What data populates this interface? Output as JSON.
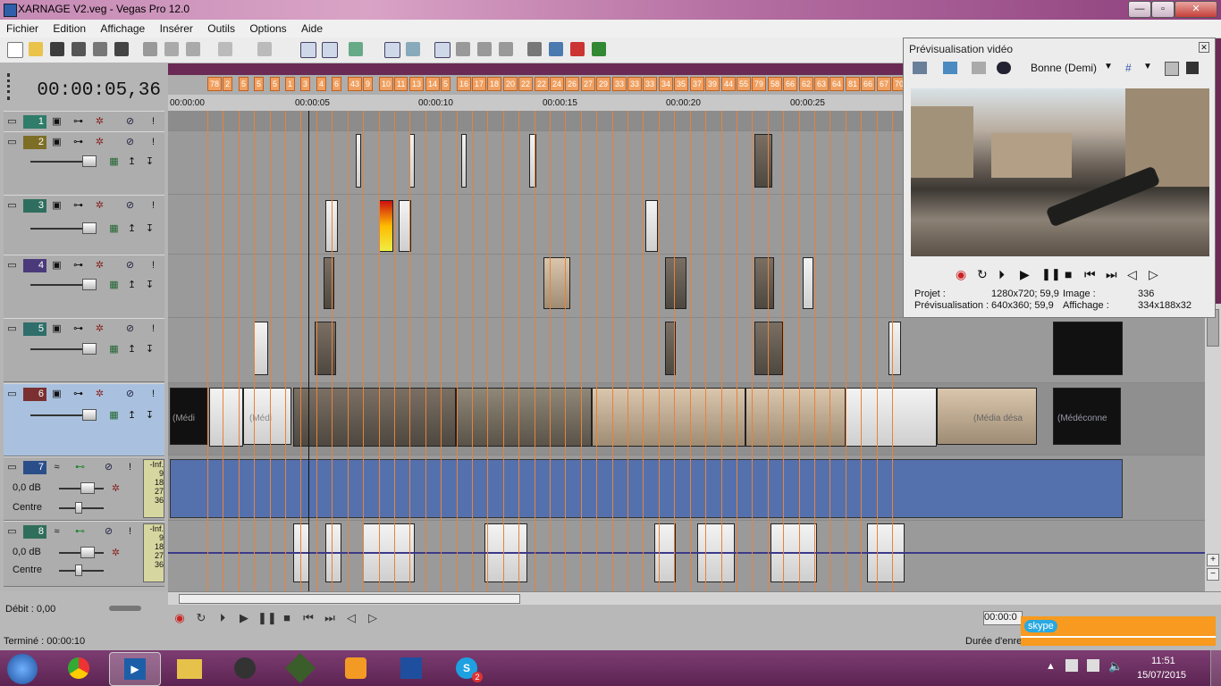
{
  "window": {
    "title": "XARNAGE V2.veg - Vegas Pro 12.0",
    "minimize": "—",
    "maximize": "▫",
    "close": "✕"
  },
  "menu": [
    "Fichier",
    "Edition",
    "Affichage",
    "Insérer",
    "Outils",
    "Options",
    "Aide"
  ],
  "timecode": "00:00:05,36",
  "markers": [
    "78",
    "2",
    "5",
    "5",
    "5",
    "1",
    "3",
    "4",
    "6",
    "43",
    "9",
    "10",
    "11",
    "13",
    "14",
    "5",
    "16",
    "17",
    "18",
    "20",
    "22",
    "22",
    "24",
    "26",
    "27",
    "29",
    "33",
    "33",
    "33",
    "34",
    "35",
    "37",
    "39",
    "44",
    "55",
    "79",
    "58",
    "66",
    "62",
    "63",
    "64",
    "81",
    "66",
    "67",
    "70"
  ],
  "ruler": [
    "00:00:00",
    "00:00:05",
    "00:00:10",
    "00:00:15",
    "00:00:20",
    "00:00:25"
  ],
  "tracks": [
    {
      "num": "1",
      "color": "#2f7c6a"
    },
    {
      "num": "2",
      "color": "#7d6e26"
    },
    {
      "num": "3",
      "color": "#2f6e5e"
    },
    {
      "num": "4",
      "color": "#4a3a7a"
    },
    {
      "num": "5",
      "color": "#2f6e6a"
    },
    {
      "num": "6",
      "color": "#7a3030"
    },
    {
      "num": "7",
      "color": "#2a4e8a",
      "db": "0,0 dB",
      "pan": "Centre",
      "meter_top": "-Inf.",
      "meter_vals": [
        "9",
        "18",
        "27",
        "36"
      ]
    },
    {
      "num": "8",
      "color": "#2f6e5a",
      "db": "0,0 dB",
      "pan": "Centre",
      "meter_top": "-Inf.",
      "meter_vals": [
        "9",
        "18",
        "27",
        "36"
      ]
    }
  ],
  "clip_labels": {
    "media": "(Médi",
    "media_desa": "(Média désa",
    "media_deconnect": "(Médéconne"
  },
  "bottom": {
    "rate": "Débit : 0,00",
    "status": "Terminé : 00:00:10",
    "time_right": "00:00:0",
    "duration": "Durée d'enre"
  },
  "preview": {
    "title": "Prévisualisation vidéo",
    "quality": "Bonne (Demi)",
    "projet_label": "Projet :",
    "projet_val": "1280x720; 59,9",
    "previs_label": "Prévisualisation :",
    "previs_val": "640x360; 59,9",
    "image_label": "Image :",
    "image_val": "336",
    "affichage_label": "Affichage :",
    "affichage_val": "334x188x32"
  },
  "skype": {
    "label": "skype"
  },
  "clock": {
    "time": "11:51",
    "date": "15/07/2015"
  },
  "taskbar_badge": "2",
  "icons": {
    "start": "windows-start-icon",
    "chrome": "chrome-icon",
    "vegas": "vegas-play-icon",
    "explorer": "folder-icon",
    "steam": "steam-icon",
    "game": "game-icon",
    "media": "media-player-icon",
    "pen": "pen-tool-icon",
    "skype": "skype-icon"
  }
}
